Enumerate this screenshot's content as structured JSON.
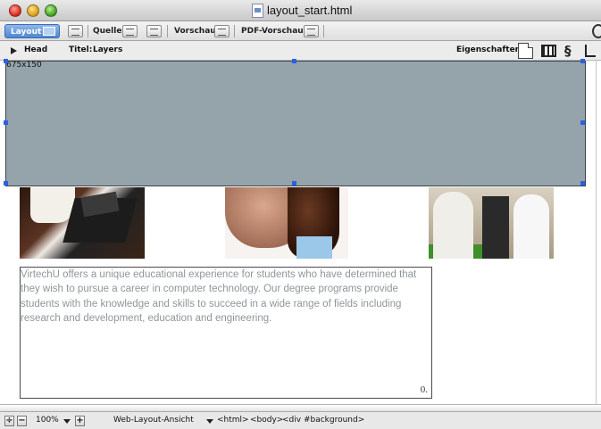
{
  "window": {
    "title": "layout_start.html"
  },
  "toolbar": {
    "layout_label": "Layout",
    "quelle_label": "Quelle",
    "vorschau_label": "Vorschau",
    "pdf_vorschau_label": "PDF-Vorschau"
  },
  "propbar": {
    "head_label": "Head",
    "titel_label": "Titel:",
    "titel_value": "Layers",
    "eigenschaften_label": "Eigenschaften:"
  },
  "layer": {
    "size_text": "675x150"
  },
  "content": {
    "body_text": "VirtechU offers a unique educational experience for students who have determined that they wish to pursue a career in computer technology. Our degree programs provide students with the knowledge and skills to succeed in a wide range of fields including research and development, education and engineering.",
    "para_mark": "0."
  },
  "statusbar": {
    "zoom": "100%",
    "view_mode": "Web-Layout-Ansicht",
    "tag_html": "<html>",
    "tag_body": "<body>",
    "tag_div": "<div #background>"
  },
  "colors": {
    "layer_fill": "#95a4ab",
    "handle": "#2b5fe8",
    "body_text": "#8f969a",
    "layout_tab": "#4d86d1"
  },
  "icons": {
    "close": "close-button-icon",
    "minimize": "minimize-button-icon",
    "zoom": "zoom-button-icon",
    "document": "html-document-icon",
    "properties_page": "page-properties-icon",
    "properties_film": "filmstrip-icon",
    "properties_link": "link-icon",
    "properties_crop": "crop-icon"
  }
}
